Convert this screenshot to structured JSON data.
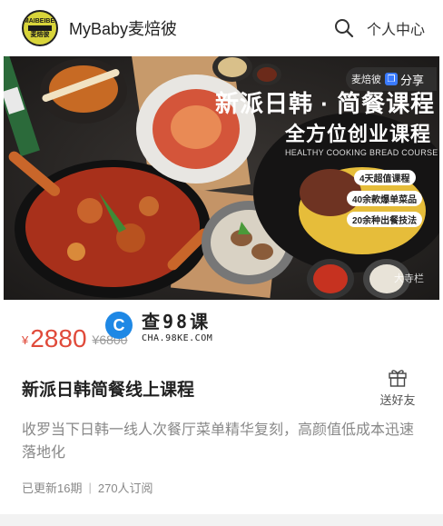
{
  "header": {
    "logo_lines": [
      "MAIBEIBEI",
      "麦焙彼"
    ],
    "brand": "MyBaby麦焙彼",
    "user_center": "个人中心",
    "search_icon": "search-icon"
  },
  "banner": {
    "share_brand": "麦焙彼",
    "share_label": "分享",
    "title_line1": "新派日韩 · 简餐课程",
    "title_line2": "全方位创业课程",
    "subtitle_en": "HEALTHY COOKING BREAD COURSE",
    "badges": [
      "4天超值课程",
      "40余款爆单菜品",
      "20余种出餐技法"
    ],
    "corner_watermark": "大寺栏"
  },
  "pricing": {
    "currency": "¥",
    "price": "2880",
    "original_price": "¥6800"
  },
  "watermark": {
    "main": "查98课",
    "sub": "CHA.98KE.COM"
  },
  "course": {
    "title": "新派日韩简餐线上课程",
    "gift_label": "送好友",
    "description": "收罗当下日韩一线人次餐厅菜单精华复刻，高颜值低成本迅速落地化",
    "updated": "已更新16期",
    "subscribers": "270人订阅"
  },
  "colors": {
    "price": "#e04a3a",
    "logo_bg": "#d8d43a",
    "share_icon": "#3a7bff",
    "watermark_icon": "#1e88e5"
  }
}
